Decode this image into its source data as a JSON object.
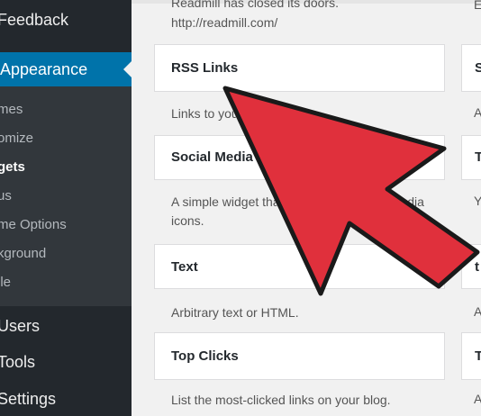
{
  "sidebar": {
    "top_item": "Feedback",
    "active_item": "Appearance",
    "submenu": [
      "mes",
      "omize",
      "gets",
      "us",
      "me Options",
      "kground",
      "ile"
    ],
    "lower_items": [
      "Users",
      "Tools",
      "Settings"
    ]
  },
  "main": {
    "intro_line1": "Readmill has closed its doors.",
    "intro_line2": "http://readmill.com/",
    "widgets": [
      {
        "title": "RSS Links",
        "description": "Links to your RSS feeds"
      },
      {
        "title": "Social Media",
        "description_line1": "A simple widget that shows your social media",
        "description_line2": "icons."
      },
      {
        "title": "Text",
        "description": "Arbitrary text or HTML."
      },
      {
        "title": "Top Clicks",
        "description": "List the most-clicked links on your blog."
      }
    ],
    "right_column": {
      "titles": [
        "S",
        "T",
        "t",
        "T"
      ],
      "descriptions": [
        "A",
        "Y",
        "A",
        "A"
      ],
      "top_letter": "E"
    }
  },
  "overlay": {
    "arrow_color": "#e0303c",
    "arrow_outline": "#1a1a1a"
  }
}
